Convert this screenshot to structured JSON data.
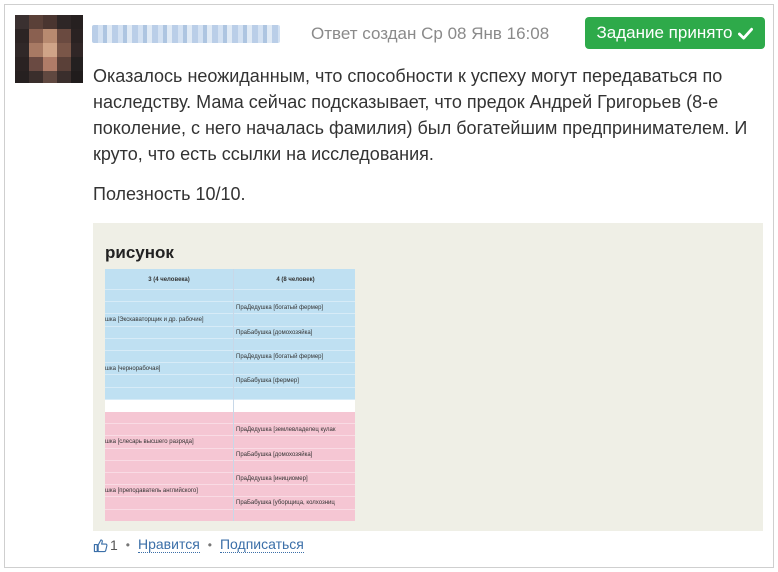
{
  "post": {
    "meta": "Ответ создан Ср 08 Янв 16:08",
    "status_button": "Задание принято",
    "paragraph": "Оказалось неожиданным, что способности к успеху могут передаваться по наследству. Мама сейчас подсказывает, что предок Андрей Григорьев (8-е поколение, с него началась фамилия) был богатейшим предпринимателем. И круто, что есть ссылки на исследования.",
    "usefulness": "Полезность 10/10."
  },
  "figure": {
    "title": "рисунок",
    "table": {
      "headers": [
        "3 (4 человека)",
        "4 (8 человек)"
      ],
      "rows": [
        {
          "color": "blue",
          "c1": "",
          "c2": ""
        },
        {
          "color": "blue",
          "c1": "",
          "c2": "ПраДедушка [богатый фермер]"
        },
        {
          "color": "blue",
          "c1": "шка [Экскаваторщик и др. рабочие]",
          "c2": ""
        },
        {
          "color": "blue",
          "c1": "",
          "c2": "ПраБабушка [домохозяйка]"
        },
        {
          "color": "blue",
          "c1": "",
          "c2": ""
        },
        {
          "color": "blue",
          "c1": "",
          "c2": "ПраДедушка [богатый фермер]"
        },
        {
          "color": "blue",
          "c1": "шка [чернорабочая]",
          "c2": ""
        },
        {
          "color": "blue",
          "c1": "",
          "c2": "ПраБабушка [фермер]"
        },
        {
          "color": "blue",
          "c1": "",
          "c2": ""
        },
        {
          "color": "white",
          "c1": "",
          "c2": ""
        },
        {
          "color": "pink",
          "c1": "",
          "c2": ""
        },
        {
          "color": "pink",
          "c1": "",
          "c2": "ПраДедушка [землевладелец кулак"
        },
        {
          "color": "pink",
          "c1": "шка [слесарь высшего разряда]",
          "c2": ""
        },
        {
          "color": "pink",
          "c1": "",
          "c2": "ПраБабушка [домохозяйка]"
        },
        {
          "color": "pink",
          "c1": "",
          "c2": ""
        },
        {
          "color": "pink",
          "c1": "",
          "c2": "ПраДедушка [инициомер]"
        },
        {
          "color": "pink",
          "c1": "шка [преподаватель английского]",
          "c2": ""
        },
        {
          "color": "pink",
          "c1": "",
          "c2": "ПраБабушка [уборщица, колхозниц"
        },
        {
          "color": "pink",
          "c1": "",
          "c2": ""
        }
      ]
    }
  },
  "footer": {
    "like_count": "1",
    "like_link": "Нравится",
    "subscribe_link": "Подписаться",
    "separator": "•"
  },
  "colors": {
    "accent_green": "#2eaa4a",
    "link_blue": "#3b6fa8",
    "table_blue": "#bfe0f2",
    "table_pink": "#f5c6d3",
    "figure_bg": "#efefe6"
  },
  "icons": {
    "status": "checkmark-icon",
    "like": "thumbs-up-icon"
  }
}
